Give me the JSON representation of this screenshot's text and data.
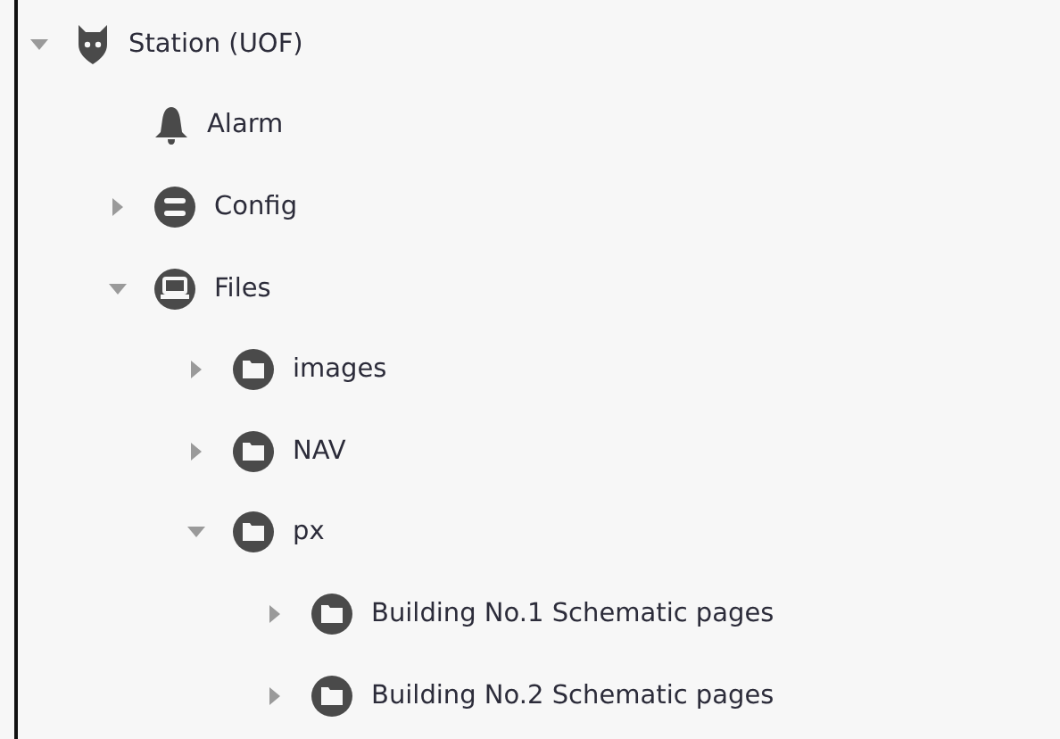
{
  "tree": [
    {
      "label": "Station (UOF)",
      "kind": "station",
      "expanded": true,
      "children": [
        {
          "label": "Alarm",
          "kind": "alarm"
        },
        {
          "label": "Config",
          "kind": "database",
          "expanded": false
        },
        {
          "label": "Files",
          "kind": "drive",
          "expanded": true,
          "children": [
            {
              "label": "images",
              "kind": "folder",
              "expanded": false
            },
            {
              "label": "NAV",
              "kind": "folder",
              "expanded": false
            },
            {
              "label": "px",
              "kind": "folder",
              "expanded": true,
              "children": [
                {
                  "label": "Building No.1 Schematic pages",
                  "kind": "folder",
                  "expanded": false
                },
                {
                  "label": "Building No.2 Schematic pages",
                  "kind": "folder",
                  "expanded": false
                }
              ]
            }
          ]
        }
      ]
    }
  ]
}
